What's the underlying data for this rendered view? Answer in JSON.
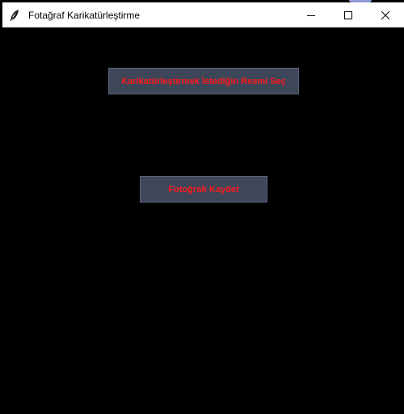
{
  "window": {
    "title": "Fotağraf Karikatürleştirme",
    "icon": "feather-icon",
    "controls": {
      "minimize": "minimize-icon",
      "maximize": "maximize-icon",
      "close": "close-icon"
    }
  },
  "main": {
    "select_image_label": "Karikatürleştirmek İstediğin Resmi Seç",
    "save_photo_label": "Fotoğrafı Kaydet"
  },
  "colors": {
    "background": "#000000",
    "button_bg": "#3e465a",
    "button_text": "#ff1a1a"
  }
}
